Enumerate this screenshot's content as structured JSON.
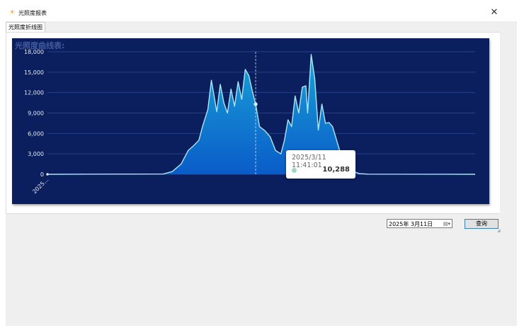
{
  "window": {
    "title": "光照度报表",
    "icon": "sun-icon",
    "close_label": "✕"
  },
  "tabs": [
    {
      "label": "光照度折线图",
      "selected": true
    }
  ],
  "chart_header": "光照度曲线表:",
  "tooltip": {
    "time": "2025/3/11 11:41:01",
    "value": "10,288"
  },
  "controls": {
    "date_value": "2025年 3月11日",
    "query_label": "查询"
  },
  "colors": {
    "chart_bg": "#0b1f5e",
    "area_top": "#1aa2d8",
    "area_bottom": "#0a5cc8",
    "line": "#a8e8f4",
    "grid": "#26408a",
    "axis_text": "#e4e8f5"
  },
  "chart_data": {
    "type": "area",
    "title": "",
    "xlabel": "",
    "ylabel": "",
    "ylim": [
      0,
      18000
    ],
    "yticks": [
      0,
      3000,
      6000,
      9000,
      12000,
      15000,
      18000
    ],
    "ytick_labels": [
      "0",
      "3,000",
      "6,000",
      "9,000",
      "12,000",
      "15,000",
      "18,000"
    ],
    "x_first_label": "2025...",
    "x_range_hours": [
      0,
      24
    ],
    "highlight": {
      "time_hours": 11.684,
      "value": 10288
    },
    "series": [
      {
        "time_hours": [
          0,
          6.5,
          7.0,
          7.5,
          7.9,
          8.2,
          8.5,
          8.7,
          9.0,
          9.2,
          9.5,
          9.7,
          9.9,
          10.1,
          10.3,
          10.5,
          10.7,
          10.9,
          11.1,
          11.3,
          11.5,
          11.684,
          11.9,
          12.2,
          12.5,
          12.8,
          13.1,
          13.3,
          13.5,
          13.7,
          13.9,
          14.1,
          14.3,
          14.5,
          14.6,
          14.8,
          15.0,
          15.2,
          15.4,
          15.6,
          15.8,
          16.0,
          16.5,
          17.0,
          17.5,
          18.0,
          24.0
        ],
        "values": [
          0,
          50,
          400,
          1500,
          3500,
          4200,
          5000,
          7000,
          9500,
          13800,
          9200,
          13200,
          10500,
          9000,
          12500,
          10000,
          13600,
          11000,
          15400,
          14500,
          12200,
          10288,
          7000,
          6400,
          5500,
          3500,
          3000,
          5000,
          8000,
          7000,
          11500,
          9000,
          12800,
          13000,
          9000,
          17600,
          14000,
          6500,
          10300,
          7500,
          7600,
          7000,
          2600,
          600,
          100,
          20,
          0
        ]
      }
    ]
  }
}
